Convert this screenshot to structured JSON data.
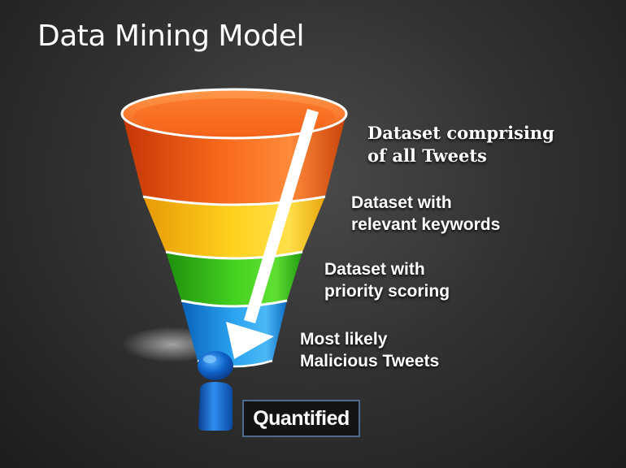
{
  "title": "Data Mining Model",
  "stages": [
    {
      "label": "Dataset comprising\nof all Tweets",
      "color": "#f05a14"
    },
    {
      "label": "Dataset with\nrelevant keywords",
      "color": "#f7b912"
    },
    {
      "label": "Dataset with\npriority scoring",
      "color": "#36b51a"
    },
    {
      "label": "Most likely\nMalicious Tweets",
      "color": "#1d8fdc"
    }
  ],
  "result": "Quantified",
  "icons": [
    "down-arrow-icon",
    "person-icon"
  ]
}
